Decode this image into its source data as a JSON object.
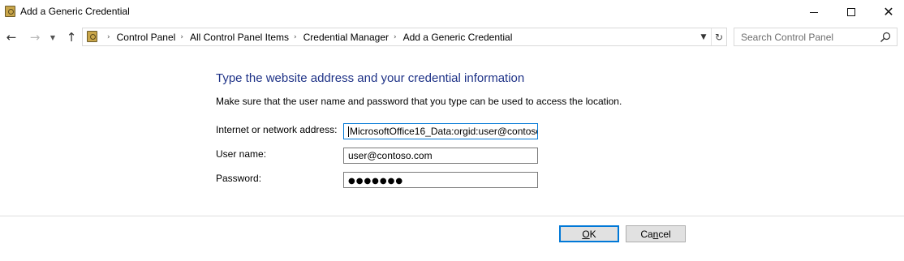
{
  "window": {
    "title": "Add a Generic Credential",
    "controls": {
      "minimize": "minimize",
      "maximize": "maximize",
      "close": "✕"
    }
  },
  "nav": {
    "back_icon": "←",
    "forward_icon": "→",
    "recent_icon": "⌄",
    "up_icon": "↑",
    "breadcrumbs": [
      "Control Panel",
      "All Control Panel Items",
      "Credential Manager",
      "Add a Generic Credential"
    ],
    "separator": "›",
    "dropdown_icon": "⌄",
    "refresh_icon": "↻",
    "search_placeholder": "Search Control Panel"
  },
  "form": {
    "heading": "Type the website address and your credential information",
    "description": "Make sure that the user name and password that you type can be used to access the location.",
    "fields": [
      {
        "label": "Internet or network address:",
        "value": "MicrosoftOffice16_Data:orgid:user@contoso"
      },
      {
        "label": "User name:",
        "value": "user@contoso.com"
      },
      {
        "label": "Password:",
        "value": "●●●●●●●"
      }
    ]
  },
  "buttons": {
    "ok": {
      "mnemonic": "O",
      "rest": "K"
    },
    "cancel": {
      "pre": "Ca",
      "mnemonic": "n",
      "rest": "cel"
    }
  },
  "colors": {
    "heading": "#1e3287",
    "focus_border": "#0078d7",
    "button_face": "#e1e1e1"
  }
}
